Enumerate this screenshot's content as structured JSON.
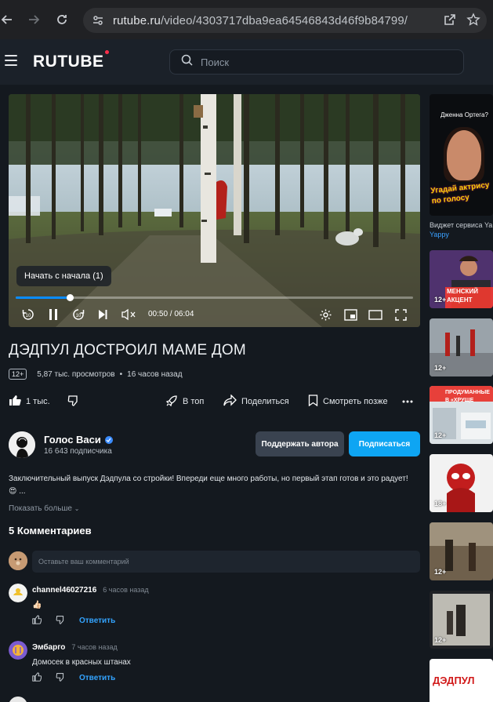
{
  "browser": {
    "url_host": "rutube.ru",
    "url_path": "/video/4303717dba9ea64546843d46f9b84799/"
  },
  "site": {
    "logo": "RUTUBE",
    "search_placeholder": "Поиск"
  },
  "player": {
    "resume_tooltip": "Начать с начала (1)",
    "current_time": "00:50",
    "duration": "06:04",
    "progress_fraction": 0.137
  },
  "video": {
    "title": "ДЭДПУЛ ДОСТРОИЛ МАМЕ ДОМ",
    "age_rating": "12+",
    "views": "5,87 тыс. просмотров",
    "posted": "16 часов назад",
    "likes": "1 тыс.",
    "top_label": "В топ",
    "share_label": "Поделиться",
    "watch_later_label": "Смотреть позже"
  },
  "channel": {
    "name": "Голос Васи",
    "subscribers": "16 643 подписчика",
    "support_label": "Поддержать автора",
    "subscribe_label": "Подписаться"
  },
  "description": {
    "text": "Заключительный выпуск Дэдпула со стройки! Впереди еще много работы, но первый этап готов и это радует!",
    "emoji": "😍 ...",
    "show_more": "Показать больше"
  },
  "comments": {
    "title": "5 Комментариев",
    "input_placeholder": "Оставьте ваш комментарий",
    "reply_label": "Ответить",
    "items": [
      {
        "author": "channel46027216",
        "time": "6 часов назад",
        "text": "👍🏻"
      },
      {
        "author": "Эмбарго",
        "time": "7 часов назад",
        "text": "Домосек в красных штанах"
      }
    ]
  },
  "sidebar": {
    "ad_heading": "Дженна Ортега?",
    "ad_overlay": "Угадай актрису по голосу",
    "ad_caption": "Виджет сервиса Ya",
    "ad_caption_link": "Yappy",
    "thumb_overlays": [
      "МЕНСКИЙ АКЦЕНТ",
      "ПРОДУМАННЫЕ В «ХРУЩЕ",
      "ДЭДПУЛ"
    ],
    "thumbnails": [
      {
        "age": "12+"
      },
      {
        "age": "12+"
      },
      {
        "age": "12+"
      },
      {
        "age": "18+"
      },
      {
        "age": "12+"
      },
      {
        "age": "12+"
      }
    ]
  }
}
